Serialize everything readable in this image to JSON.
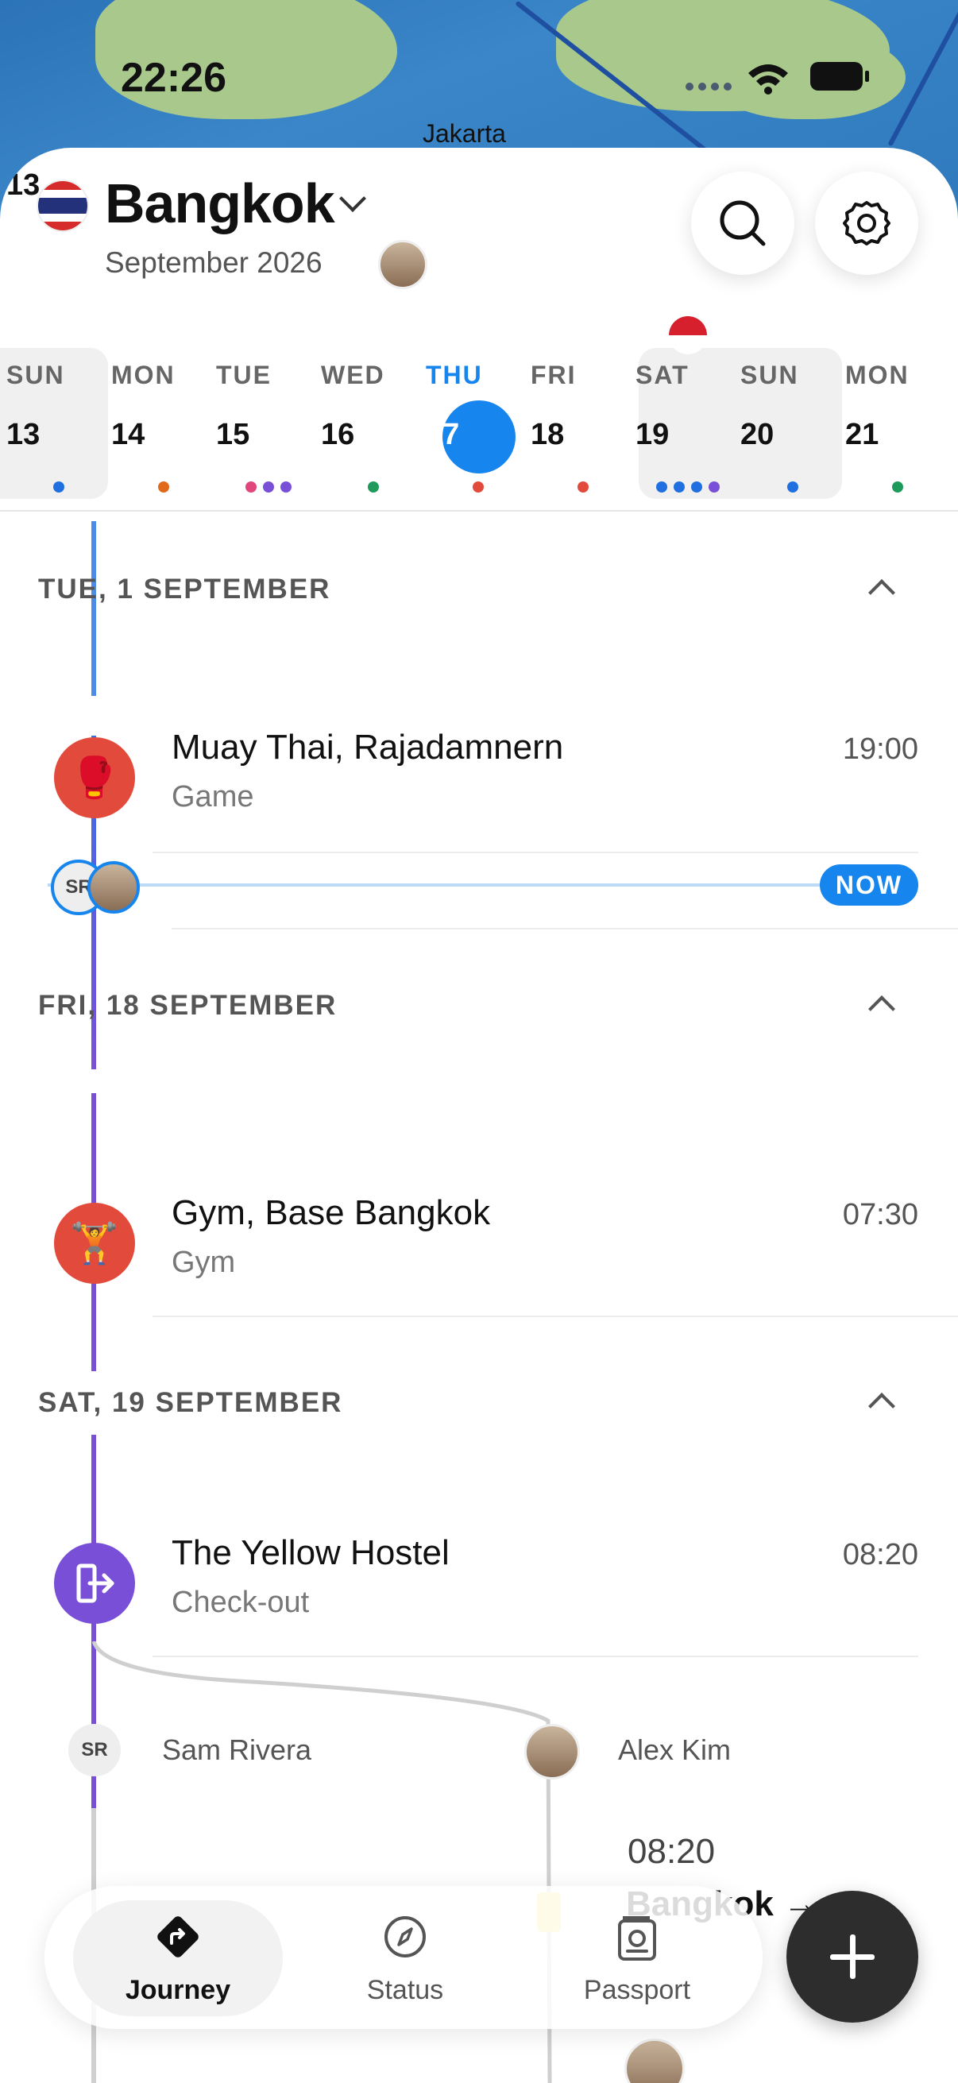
{
  "status_bar": {
    "time": "22:26"
  },
  "map": {
    "city_label": "Jakarta"
  },
  "header": {
    "city": "Bangkok",
    "subtitle": "September 2026"
  },
  "calendar": {
    "days": [
      {
        "dow": "SUN",
        "num": "13"
      },
      {
        "dow": "MON",
        "num": "14"
      },
      {
        "dow": "TUE",
        "num": "15"
      },
      {
        "dow": "WED",
        "num": "16"
      },
      {
        "dow": "THU",
        "num": "17"
      },
      {
        "dow": "FRI",
        "num": "18"
      },
      {
        "dow": "SAT",
        "num": "19"
      },
      {
        "dow": "SUN",
        "num": "20"
      },
      {
        "dow": "MON",
        "num": "21"
      }
    ],
    "colors": {
      "accent": "#1785ee",
      "purple": "#7a4fd8",
      "red": "#e24b3b",
      "green": "#1e9a5a",
      "orange": "#e06a1a",
      "pink": "#e0457b"
    }
  },
  "timeline": {
    "sections": [
      {
        "heading": "TUE, 1 SEPTEMBER",
        "events": [
          {
            "title": "Muay Thai, Rajadamnern",
            "subtitle": "Game",
            "time": "19:00",
            "icon": "boxing-glove-icon"
          }
        ]
      },
      {
        "heading": "FRI, 18 SEPTEMBER",
        "events": [
          {
            "title": "Gym, Base Bangkok",
            "subtitle": "Gym",
            "time": "07:30",
            "icon": "weightlifter-icon"
          }
        ]
      },
      {
        "heading": "SAT, 19 SEPTEMBER",
        "events": [
          {
            "title": "The Yellow Hostel",
            "subtitle": "Check-out",
            "time": "08:20",
            "icon": "check-out-icon"
          }
        ]
      }
    ],
    "now_label": "NOW",
    "now_initials": "SR",
    "split": {
      "left": {
        "initials": "SR",
        "name": "Sam Rivera"
      },
      "right": {
        "name": "Alex Kim",
        "time": "08:20",
        "title_partial": "Bangkok →"
      }
    }
  },
  "tabbar": {
    "tabs": [
      {
        "label": "Journey",
        "icon": "route-icon"
      },
      {
        "label": "Status",
        "icon": "compass-icon"
      },
      {
        "label": "Passport",
        "icon": "passport-icon"
      }
    ],
    "fab_icon": "plus-icon"
  }
}
